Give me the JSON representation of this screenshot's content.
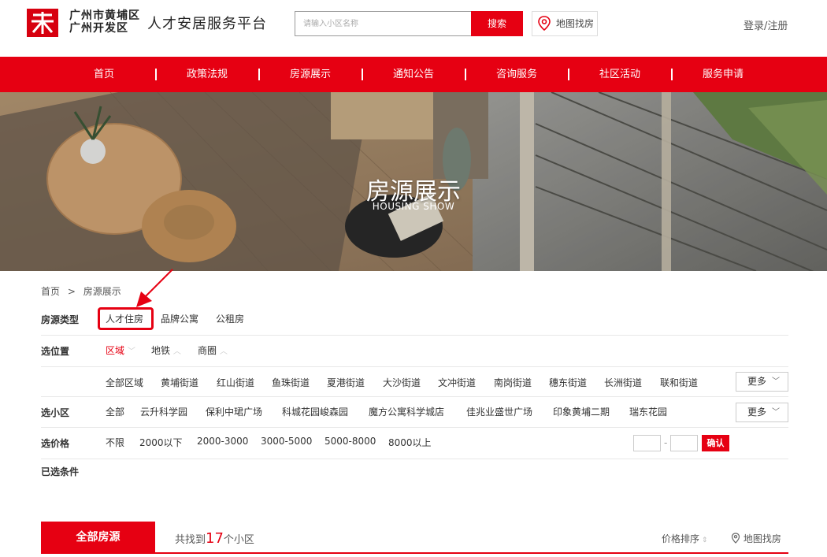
{
  "header": {
    "org_line1": "广州市黄埔区",
    "org_line2": "广州开发区",
    "title": "人才安居服务平台",
    "search_placeholder": "请输入小区名称",
    "search_button": "搜索",
    "map_button": "地图找房",
    "login": "登录/注册"
  },
  "nav": {
    "items": [
      "首页",
      "政策法规",
      "房源展示",
      "通知公告",
      "咨询服务",
      "社区活动",
      "服务申请"
    ]
  },
  "banner": {
    "title": "房源展示",
    "subtitle": "HOUSING SHOW"
  },
  "breadcrumb": {
    "home": "首页",
    "sep": ">",
    "current": "房源展示"
  },
  "filters": {
    "type": {
      "label": "房源类型",
      "options": [
        "人才住房",
        "品牌公寓",
        "公租房"
      ],
      "selected": "人才住房"
    },
    "location": {
      "label": "选位置",
      "modes": [
        "区域",
        "地铁",
        "商圈"
      ],
      "selected_mode": "区域",
      "areas": [
        "全部区域",
        "黄埔街道",
        "红山街道",
        "鱼珠街道",
        "夏港街道",
        "大沙街道",
        "文冲街道",
        "南岗街道",
        "穗东街道",
        "长洲街道",
        "联和街道"
      ],
      "more": "更多"
    },
    "community": {
      "label": "选小区",
      "options": [
        "全部",
        "云升科学园",
        "保利中珺广场",
        "科城花园峻森园",
        "魔方公寓科学城店",
        "佳兆业盛世广场",
        "印象黄埔二期",
        "瑞东花园"
      ],
      "more": "更多"
    },
    "price": {
      "label": "选价格",
      "options": [
        "不限",
        "2000以下",
        "2000-3000",
        "3000-5000",
        "5000-8000",
        "8000以上"
      ],
      "range_sep": "-",
      "confirm": "确认"
    },
    "selected_label": "已选条件"
  },
  "results": {
    "tab_all": "全部房源",
    "found_prefix": "共找到",
    "count": "17",
    "found_suffix": "个小区",
    "sort": "价格排序",
    "map": "地图找房"
  },
  "colors": {
    "brand": "#e60012"
  }
}
